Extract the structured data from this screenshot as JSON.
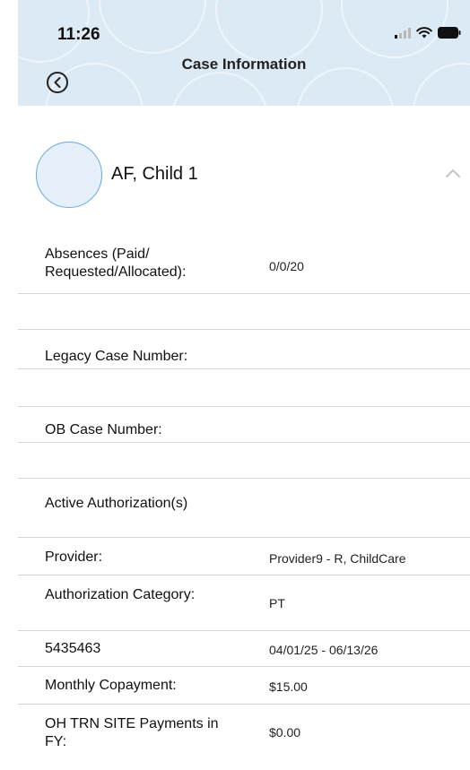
{
  "status_bar": {
    "time": "11:26"
  },
  "header": {
    "title": "Case Information"
  },
  "child": {
    "name": "AF, Child 1"
  },
  "rows": [
    {
      "label": "Absences (Paid/ Requested/Allocated):",
      "value": "0/0/20"
    },
    {
      "label": "Legacy Case Number:",
      "value": ""
    },
    {
      "label": "OB Case Number:",
      "value": ""
    },
    {
      "label": "Active Authorization(s)",
      "value": ""
    },
    {
      "label": "Provider:",
      "value": "Provider9 - R, ChildCare"
    },
    {
      "label": "Authorization Category:",
      "value": "PT"
    },
    {
      "label": "5435463",
      "value": "04/01/25 - 06/13/26"
    },
    {
      "label": "Monthly Copayment:",
      "value": "$15.00"
    },
    {
      "label": "OH TRN SITE Payments in FY:",
      "value": "$0.00"
    }
  ],
  "icons": {
    "back": "back-circle-icon",
    "collapse": "chevron-up-icon",
    "signal": "signal-icon",
    "wifi": "wifi-icon",
    "battery": "battery-icon"
  }
}
